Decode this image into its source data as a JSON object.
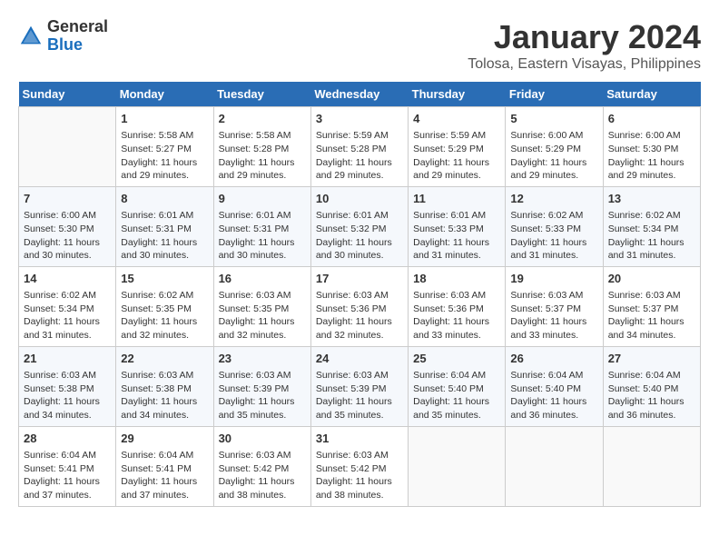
{
  "header": {
    "logo_general": "General",
    "logo_blue": "Blue",
    "month": "January 2024",
    "location": "Tolosa, Eastern Visayas, Philippines"
  },
  "weekdays": [
    "Sunday",
    "Monday",
    "Tuesday",
    "Wednesday",
    "Thursday",
    "Friday",
    "Saturday"
  ],
  "weeks": [
    [
      {
        "day": "",
        "info": ""
      },
      {
        "day": "1",
        "info": "Sunrise: 5:58 AM\nSunset: 5:27 PM\nDaylight: 11 hours\nand 29 minutes."
      },
      {
        "day": "2",
        "info": "Sunrise: 5:58 AM\nSunset: 5:28 PM\nDaylight: 11 hours\nand 29 minutes."
      },
      {
        "day": "3",
        "info": "Sunrise: 5:59 AM\nSunset: 5:28 PM\nDaylight: 11 hours\nand 29 minutes."
      },
      {
        "day": "4",
        "info": "Sunrise: 5:59 AM\nSunset: 5:29 PM\nDaylight: 11 hours\nand 29 minutes."
      },
      {
        "day": "5",
        "info": "Sunrise: 6:00 AM\nSunset: 5:29 PM\nDaylight: 11 hours\nand 29 minutes."
      },
      {
        "day": "6",
        "info": "Sunrise: 6:00 AM\nSunset: 5:30 PM\nDaylight: 11 hours\nand 29 minutes."
      }
    ],
    [
      {
        "day": "7",
        "info": "Sunrise: 6:00 AM\nSunset: 5:30 PM\nDaylight: 11 hours\nand 30 minutes."
      },
      {
        "day": "8",
        "info": "Sunrise: 6:01 AM\nSunset: 5:31 PM\nDaylight: 11 hours\nand 30 minutes."
      },
      {
        "day": "9",
        "info": "Sunrise: 6:01 AM\nSunset: 5:31 PM\nDaylight: 11 hours\nand 30 minutes."
      },
      {
        "day": "10",
        "info": "Sunrise: 6:01 AM\nSunset: 5:32 PM\nDaylight: 11 hours\nand 30 minutes."
      },
      {
        "day": "11",
        "info": "Sunrise: 6:01 AM\nSunset: 5:33 PM\nDaylight: 11 hours\nand 31 minutes."
      },
      {
        "day": "12",
        "info": "Sunrise: 6:02 AM\nSunset: 5:33 PM\nDaylight: 11 hours\nand 31 minutes."
      },
      {
        "day": "13",
        "info": "Sunrise: 6:02 AM\nSunset: 5:34 PM\nDaylight: 11 hours\nand 31 minutes."
      }
    ],
    [
      {
        "day": "14",
        "info": "Sunrise: 6:02 AM\nSunset: 5:34 PM\nDaylight: 11 hours\nand 31 minutes."
      },
      {
        "day": "15",
        "info": "Sunrise: 6:02 AM\nSunset: 5:35 PM\nDaylight: 11 hours\nand 32 minutes."
      },
      {
        "day": "16",
        "info": "Sunrise: 6:03 AM\nSunset: 5:35 PM\nDaylight: 11 hours\nand 32 minutes."
      },
      {
        "day": "17",
        "info": "Sunrise: 6:03 AM\nSunset: 5:36 PM\nDaylight: 11 hours\nand 32 minutes."
      },
      {
        "day": "18",
        "info": "Sunrise: 6:03 AM\nSunset: 5:36 PM\nDaylight: 11 hours\nand 33 minutes."
      },
      {
        "day": "19",
        "info": "Sunrise: 6:03 AM\nSunset: 5:37 PM\nDaylight: 11 hours\nand 33 minutes."
      },
      {
        "day": "20",
        "info": "Sunrise: 6:03 AM\nSunset: 5:37 PM\nDaylight: 11 hours\nand 34 minutes."
      }
    ],
    [
      {
        "day": "21",
        "info": "Sunrise: 6:03 AM\nSunset: 5:38 PM\nDaylight: 11 hours\nand 34 minutes."
      },
      {
        "day": "22",
        "info": "Sunrise: 6:03 AM\nSunset: 5:38 PM\nDaylight: 11 hours\nand 34 minutes."
      },
      {
        "day": "23",
        "info": "Sunrise: 6:03 AM\nSunset: 5:39 PM\nDaylight: 11 hours\nand 35 minutes."
      },
      {
        "day": "24",
        "info": "Sunrise: 6:03 AM\nSunset: 5:39 PM\nDaylight: 11 hours\nand 35 minutes."
      },
      {
        "day": "25",
        "info": "Sunrise: 6:04 AM\nSunset: 5:40 PM\nDaylight: 11 hours\nand 35 minutes."
      },
      {
        "day": "26",
        "info": "Sunrise: 6:04 AM\nSunset: 5:40 PM\nDaylight: 11 hours\nand 36 minutes."
      },
      {
        "day": "27",
        "info": "Sunrise: 6:04 AM\nSunset: 5:40 PM\nDaylight: 11 hours\nand 36 minutes."
      }
    ],
    [
      {
        "day": "28",
        "info": "Sunrise: 6:04 AM\nSunset: 5:41 PM\nDaylight: 11 hours\nand 37 minutes."
      },
      {
        "day": "29",
        "info": "Sunrise: 6:04 AM\nSunset: 5:41 PM\nDaylight: 11 hours\nand 37 minutes."
      },
      {
        "day": "30",
        "info": "Sunrise: 6:03 AM\nSunset: 5:42 PM\nDaylight: 11 hours\nand 38 minutes."
      },
      {
        "day": "31",
        "info": "Sunrise: 6:03 AM\nSunset: 5:42 PM\nDaylight: 11 hours\nand 38 minutes."
      },
      {
        "day": "",
        "info": ""
      },
      {
        "day": "",
        "info": ""
      },
      {
        "day": "",
        "info": ""
      }
    ]
  ]
}
